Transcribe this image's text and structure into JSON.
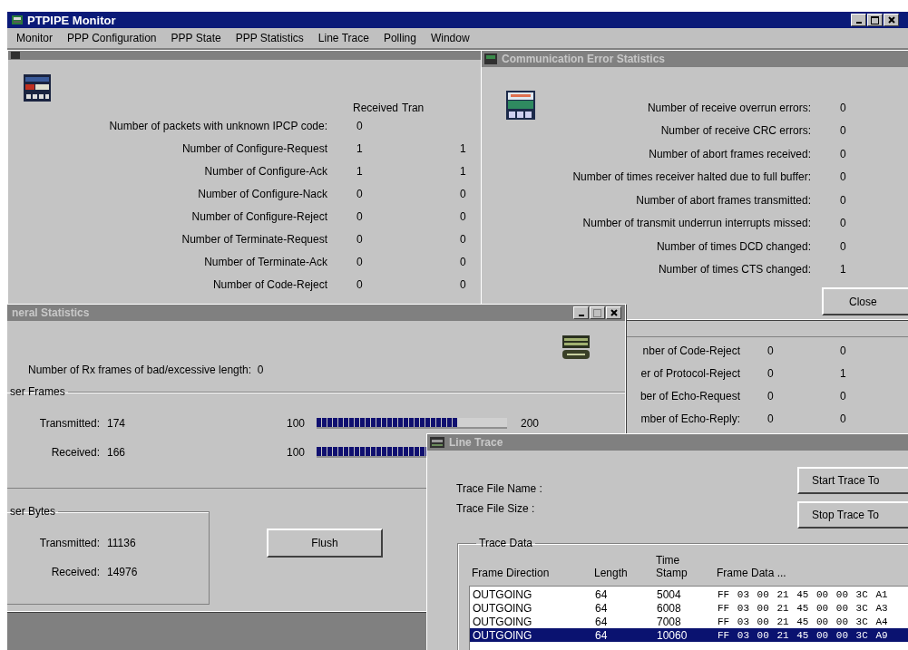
{
  "app": {
    "title": "PTPIPE Monitor",
    "menu": [
      "Monitor",
      "PPP Configuration",
      "PPP State",
      "PPP Statistics",
      "Line Trace",
      "Polling",
      "Window"
    ]
  },
  "ipcp_window": {
    "columns": [
      "Received",
      "Tran"
    ],
    "rows": [
      {
        "label": "Number of packets with unknown IPCP code:",
        "received": "0"
      },
      {
        "label": "Number of Configure-Request",
        "received": "1",
        "transmitted": "1"
      },
      {
        "label": "Number of Configure-Ack",
        "received": "1",
        "transmitted": "1"
      },
      {
        "label": "Number of Configure-Nack",
        "received": "0",
        "transmitted": "0"
      },
      {
        "label": "Number of Configure-Reject",
        "received": "0",
        "transmitted": "0"
      },
      {
        "label": "Number of Terminate-Request",
        "received": "0",
        "transmitted": "0"
      },
      {
        "label": "Number of Terminate-Ack",
        "received": "0",
        "transmitted": "0"
      },
      {
        "label": "Number of Code-Reject",
        "received": "0",
        "transmitted": "0"
      }
    ]
  },
  "lcp_window": {
    "rows": [
      {
        "label": "nber of Code-Reject",
        "received": "0",
        "transmitted": "0"
      },
      {
        "label": "er of Protocol-Reject",
        "received": "0",
        "transmitted": "1"
      },
      {
        "label": "ber of Echo-Request",
        "received": "0",
        "transmitted": "0"
      },
      {
        "label": "mber of Echo-Reply:",
        "received": "0",
        "transmitted": "0"
      }
    ]
  },
  "comm_window": {
    "title": "Communication Error Statistics",
    "rows": [
      {
        "label": "Number of receive overrun errors:",
        "value": "0"
      },
      {
        "label": "Number of receive CRC errors:",
        "value": "0"
      },
      {
        "label": "Number of abort frames received:",
        "value": "0"
      },
      {
        "label": "Number of times receiver halted due to full buffer:",
        "value": "0"
      },
      {
        "label": "Number of abort frames transmitted:",
        "value": "0"
      },
      {
        "label": "Number of transmit underrun interrupts missed:",
        "value": "0"
      },
      {
        "label": "Number of times DCD changed:",
        "value": "0"
      },
      {
        "label": "Number of times CTS changed:",
        "value": "1"
      }
    ],
    "close_button": "Close"
  },
  "general_window": {
    "title": "neral Statistics",
    "bad_length": {
      "label": "Number of Rx frames of bad/excessive length:",
      "value": "0"
    },
    "frames": {
      "legend": "ser Frames",
      "rows": [
        {
          "label": "Transmitted:",
          "value": "174",
          "min": "100",
          "max": "200",
          "level": 0.74
        },
        {
          "label": "Received:",
          "value": "166",
          "min": "100",
          "level": 0.66
        }
      ]
    },
    "bytes": {
      "legend": "ser Bytes",
      "rows": [
        {
          "label": "Transmitted:",
          "value": "11136"
        },
        {
          "label": "Received:",
          "value": "14976"
        }
      ]
    },
    "flush_button": "Flush"
  },
  "trace_window": {
    "title": "Line Trace",
    "fields": [
      "Trace File Name :",
      "Trace File Size :"
    ],
    "buttons": [
      "Start Trace To",
      "Stop Trace To"
    ],
    "legend": "Trace Data",
    "columns": [
      "Frame Direction",
      "Length",
      "Time Stamp",
      "Frame Data ..."
    ],
    "rows": [
      {
        "direction": "OUTGOING",
        "length": "64",
        "stamp": "5004",
        "data": "FF 03 00 21 45 00 00 3C A1",
        "selected": false
      },
      {
        "direction": "OUTGOING",
        "length": "64",
        "stamp": "6008",
        "data": "FF 03 00 21 45 00 00 3C A3",
        "selected": false
      },
      {
        "direction": "OUTGOING",
        "length": "64",
        "stamp": "7008",
        "data": "FF 03 00 21 45 00 00 3C A4",
        "selected": false
      },
      {
        "direction": "OUTGOING",
        "length": "64",
        "stamp": "10060",
        "data": "FF 03 00 21 45 00 00 3C A9",
        "selected": true
      }
    ]
  }
}
